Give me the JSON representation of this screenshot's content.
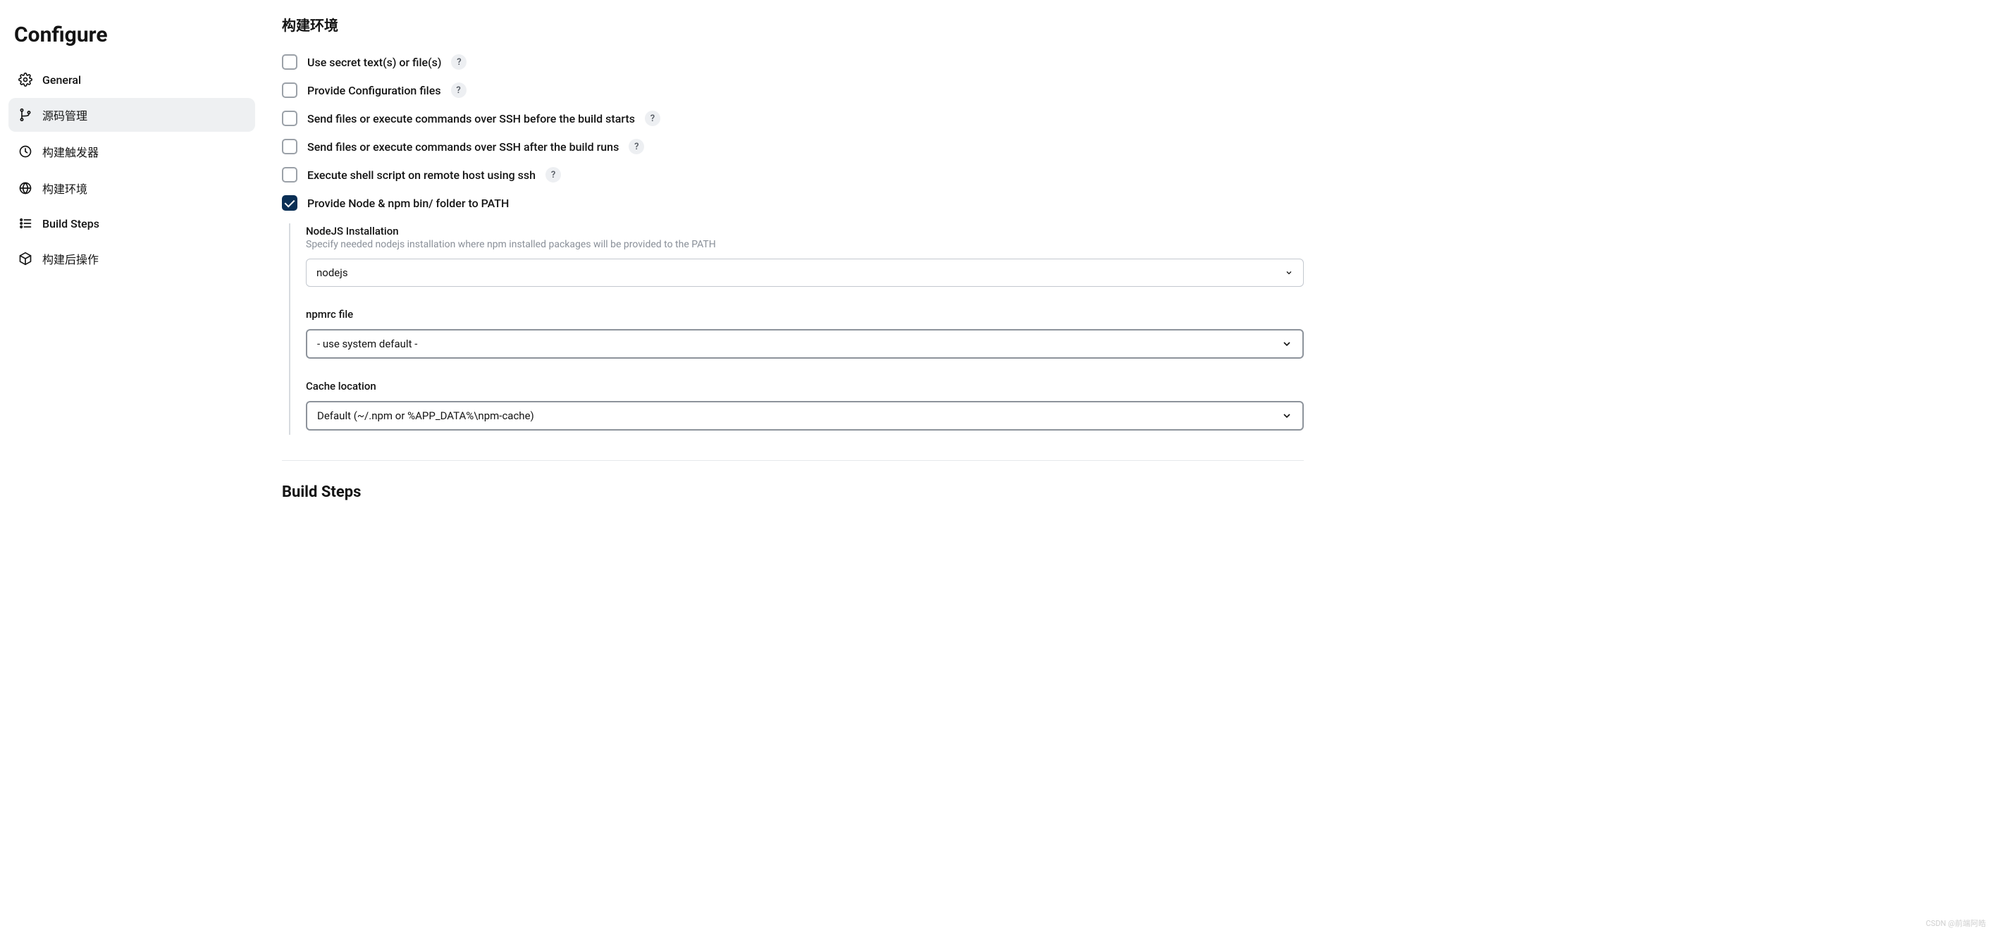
{
  "sidebar": {
    "title": "Configure",
    "items": [
      {
        "label": "General",
        "icon": "gear-icon"
      },
      {
        "label": "源码管理",
        "icon": "branch-icon",
        "active": true
      },
      {
        "label": "构建触发器",
        "icon": "clock-icon"
      },
      {
        "label": "构建环境",
        "icon": "globe-icon"
      },
      {
        "label": "Build Steps",
        "icon": "steps-icon"
      },
      {
        "label": "构建后操作",
        "icon": "package-icon"
      }
    ]
  },
  "section": {
    "title": "构建环境",
    "options": [
      {
        "label": "Use secret text(s) or file(s)",
        "checked": false,
        "help": true
      },
      {
        "label": "Provide Configuration files",
        "checked": false,
        "help": true
      },
      {
        "label": "Send files or execute commands over SSH before the build starts",
        "checked": false,
        "help": true
      },
      {
        "label": "Send files or execute commands over SSH after the build runs",
        "checked": false,
        "help": true
      },
      {
        "label": "Execute shell script on remote host using ssh",
        "checked": false,
        "help": true
      },
      {
        "label": "Provide Node & npm bin/ folder to PATH",
        "checked": true,
        "help": false
      }
    ]
  },
  "nodejs": {
    "install_label": "NodeJS Installation",
    "install_desc": "Specify needed nodejs installation where npm installed packages will be provided to the PATH",
    "install_value": "nodejs",
    "npmrc_label": "npmrc file",
    "npmrc_value": "- use system default -",
    "cache_label": "Cache location",
    "cache_value": "Default (~/.npm or %APP_DATA%\\npm-cache)"
  },
  "build_steps_title": "Build Steps",
  "help_glyph": "?",
  "watermark": "CSDN @前端阿皓"
}
